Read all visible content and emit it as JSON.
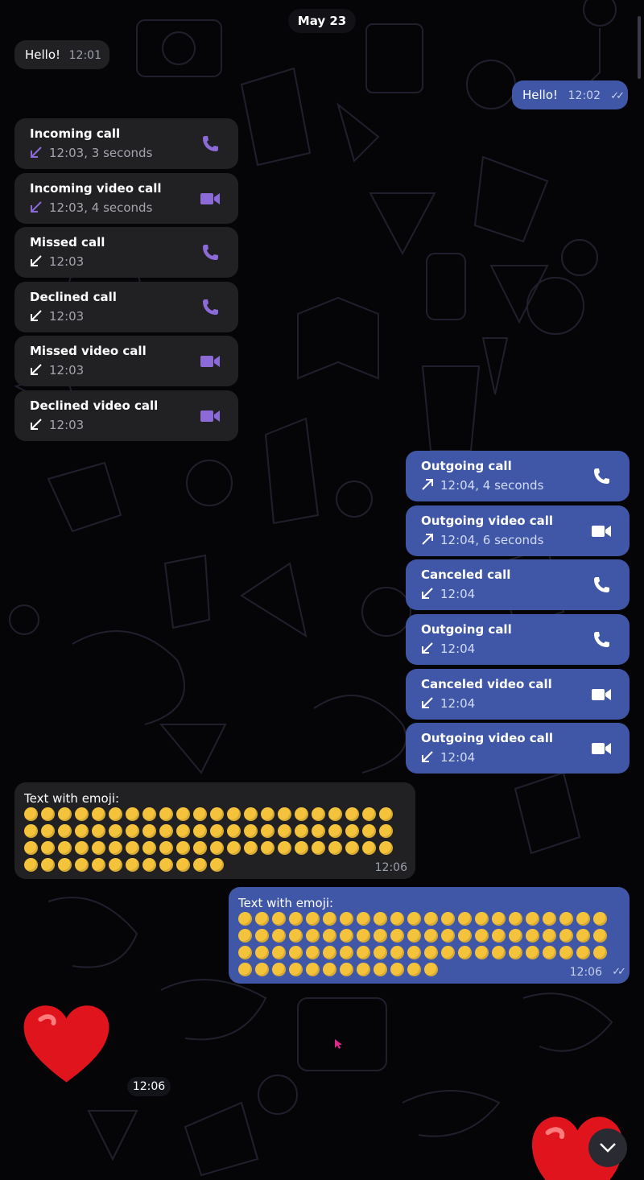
{
  "date_label": "May 23",
  "messages": {
    "hello_in": {
      "text": "Hello!",
      "time": "12:01"
    },
    "hello_out": {
      "text": "Hello!",
      "time": "12:02"
    }
  },
  "calls_in": [
    {
      "title": "Incoming call",
      "sub": "12:03, 3 seconds",
      "icon": "phone-icon",
      "arrow": "incoming-arrow-icon"
    },
    {
      "title": "Incoming video call",
      "sub": "12:03, 4 seconds",
      "icon": "video-icon",
      "arrow": "incoming-arrow-icon"
    },
    {
      "title": "Missed call",
      "sub": "12:03",
      "icon": "phone-icon",
      "arrow": "missed-arrow-icon"
    },
    {
      "title": "Declined call",
      "sub": "12:03",
      "icon": "phone-icon",
      "arrow": "missed-arrow-icon"
    },
    {
      "title": "Missed video call",
      "sub": "12:03",
      "icon": "video-icon",
      "arrow": "missed-arrow-icon"
    },
    {
      "title": "Declined video call",
      "sub": "12:03",
      "icon": "video-icon",
      "arrow": "missed-arrow-icon"
    }
  ],
  "calls_out": [
    {
      "title": "Outgoing call",
      "sub": "12:04, 4 seconds",
      "icon": "phone-icon",
      "arrow": "outgoing-arrow-icon"
    },
    {
      "title": "Outgoing video call",
      "sub": "12:04, 6 seconds",
      "icon": "video-icon",
      "arrow": "outgoing-arrow-icon"
    },
    {
      "title": "Canceled call",
      "sub": "12:04",
      "icon": "phone-icon",
      "arrow": "missed-arrow-icon"
    },
    {
      "title": "Outgoing call",
      "sub": "12:04",
      "icon": "phone-icon",
      "arrow": "missed-arrow-icon"
    },
    {
      "title": "Canceled video call",
      "sub": "12:04",
      "icon": "video-icon",
      "arrow": "missed-arrow-icon"
    },
    {
      "title": "Outgoing video call",
      "sub": "12:04",
      "icon": "video-icon",
      "arrow": "missed-arrow-icon"
    }
  ],
  "emoji_in": {
    "lead": "Text with emoji:",
    "time": "12:06"
  },
  "emoji_out": {
    "lead": "Text with emoji:",
    "time": "12:06"
  },
  "heart_time": "12:06",
  "colors": {
    "incoming_bubble": "#212124",
    "outgoing_bubble": "#3f57a6",
    "accent_purple": "#8c6ad8",
    "accent_white": "#ffffff"
  }
}
